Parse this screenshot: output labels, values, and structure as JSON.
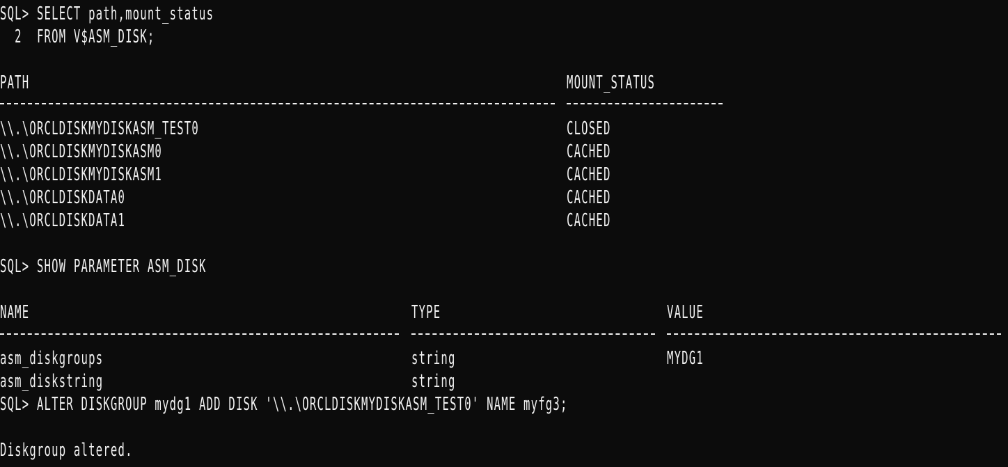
{
  "terminal": {
    "query1": {
      "line1": "SQL> SELECT path,mount_status",
      "line2": "  2  FROM V$ASM_DISK;",
      "headers": {
        "path": "PATH",
        "mount_status": "MOUNT_STATUS"
      },
      "rows": [
        {
          "path": "\\\\.\\ORCLDISKMYDISKASM_TEST0",
          "status": "CLOSED"
        },
        {
          "path": "\\\\.\\ORCLDISKMYDISKASM0",
          "status": "CACHED"
        },
        {
          "path": "\\\\.\\ORCLDISKMYDISKASM1",
          "status": "CACHED"
        },
        {
          "path": "\\\\.\\ORCLDISKDATA0",
          "status": "CACHED"
        },
        {
          "path": "\\\\.\\ORCLDISKDATA1",
          "status": "CACHED"
        }
      ]
    },
    "query2": {
      "command": "SQL> SHOW PARAMETER ASM_DISK",
      "headers": {
        "name": "NAME",
        "type": "TYPE",
        "value": "VALUE"
      },
      "rows": [
        {
          "name": "asm_diskgroups",
          "type": "string",
          "value": "MYDG1"
        },
        {
          "name": "asm_diskstring",
          "type": "string",
          "value": ""
        }
      ]
    },
    "query3": {
      "command": "SQL> ALTER DISKGROUP mydg1 ADD DISK '\\\\.\\ORCLDISKMYDISKASM_TEST0' NAME myfg3;",
      "result": "Diskgroup altered."
    }
  }
}
